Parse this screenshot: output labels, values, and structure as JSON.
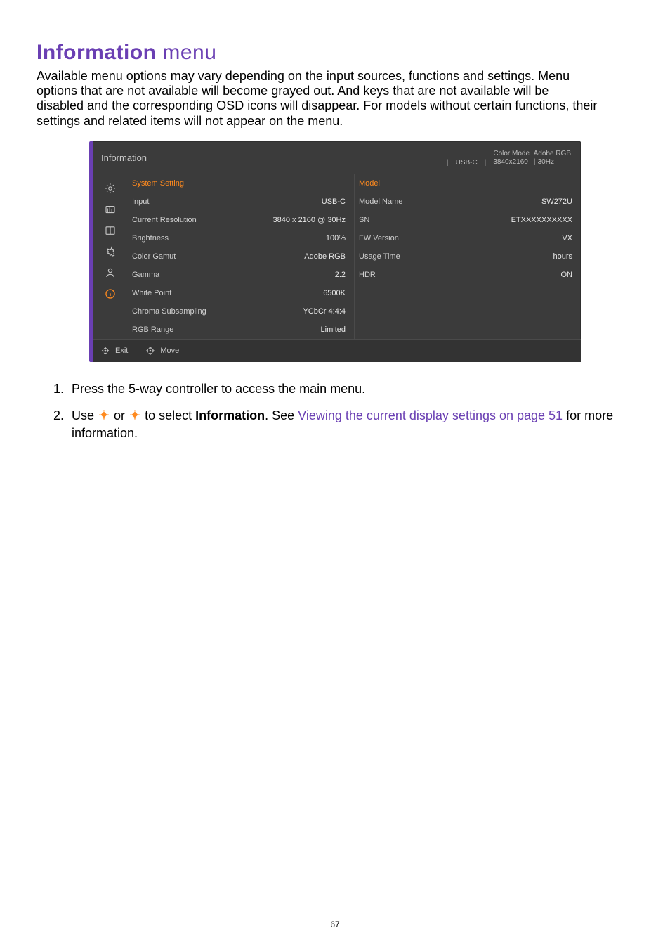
{
  "page_number": "67",
  "heading": {
    "bold": "Information",
    "rest": " menu"
  },
  "intro": "Available menu options may vary depending on the input sources, functions and settings. Menu options that are not available will become grayed out. And keys that are not available will be disabled and the corresponding OSD icons will disappear. For models without certain functions, their settings and related items will not appear on the menu.",
  "osd": {
    "title": "Information",
    "status": {
      "colormode_label": "Color Mode",
      "colormode_value": "Adobe RGB",
      "input": "USB-C",
      "resolution": "3840x2160",
      "refresh": "30Hz"
    },
    "left": [
      {
        "label": "System Setting",
        "val": "",
        "header": true
      },
      {
        "label": "Input",
        "val": "USB-C"
      },
      {
        "label": "Current Resolution",
        "val": "3840 x 2160 @ 30Hz"
      },
      {
        "label": "Brightness",
        "val": "100%"
      },
      {
        "label": "Color Gamut",
        "val": "Adobe RGB"
      },
      {
        "label": "Gamma",
        "val": "2.2"
      },
      {
        "label": "White Point",
        "val": "6500K"
      },
      {
        "label": "Chroma Subsampling",
        "val": "YCbCr 4:4:4"
      },
      {
        "label": "RGB Range",
        "val": "Limited"
      }
    ],
    "right": [
      {
        "label": "Model",
        "val": "",
        "header": true
      },
      {
        "label": "Model Name",
        "val": "SW272U",
        "orange": true
      },
      {
        "label": "SN",
        "val": "ETXXXXXXXXXX",
        "orange": true
      },
      {
        "label": "FW Version",
        "val": "VX",
        "orange": true
      },
      {
        "label": "Usage Time",
        "val": "hours",
        "orange": true
      },
      {
        "label": "HDR",
        "val": "ON",
        "orange": true
      }
    ],
    "footer": {
      "exit": "Exit",
      "move": "Move"
    }
  },
  "steps": {
    "s1": "Press the 5-way controller to access the main menu.",
    "s2_a": "Use ",
    "s2_b": " or ",
    "s2_c": " to select ",
    "s2_bold": "Information",
    "s2_d": ". See ",
    "s2_link": "Viewing the current display settings on page 51",
    "s2_e": " for more information."
  }
}
